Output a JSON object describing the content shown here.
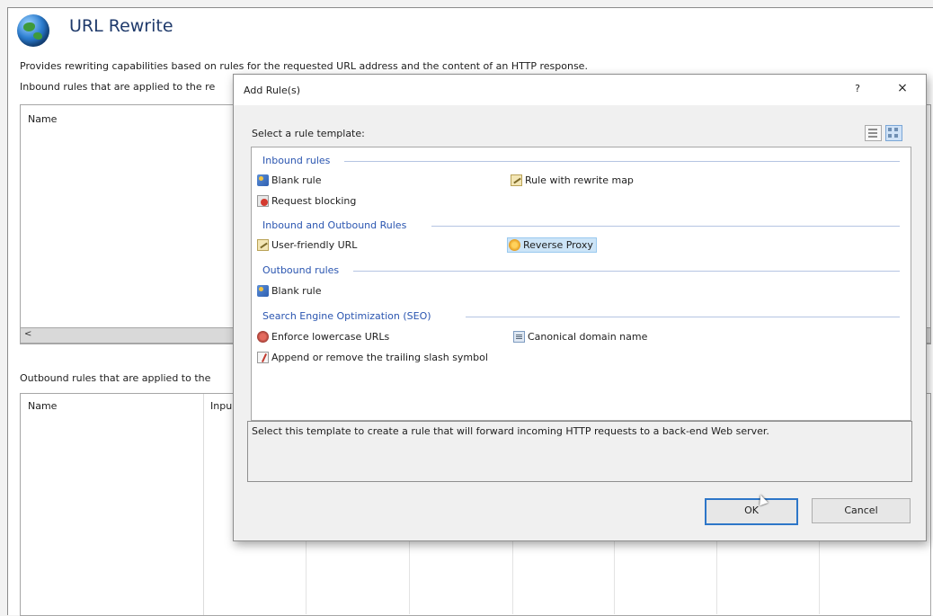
{
  "page": {
    "title": "URL Rewrite",
    "description": "Provides rewriting capabilities based on rules for the requested URL address and the content of an HTTP response.",
    "inbound_label": "Inbound rules that are applied to the re",
    "outbound_label": "Outbound rules that are applied to the",
    "inbound_grid": {
      "columns": [
        "Name"
      ],
      "scroll_left_arrow": "<"
    },
    "outbound_grid": {
      "columns": [
        "Name",
        "Inpu"
      ]
    },
    "icon": "globe-icon"
  },
  "dialog": {
    "title": "Add Rule(s)",
    "help": "?",
    "close": "×",
    "select_label": "Select a rule template:",
    "view_buttons": [
      "list-view-icon",
      "tile-view-icon"
    ],
    "groups": [
      {
        "heading": "Inbound rules",
        "items": [
          {
            "label": "Blank rule",
            "icon": "blank-rule-icon"
          },
          {
            "label": "Rule with rewrite map",
            "icon": "rewrite-map-icon"
          },
          {
            "label": "Request blocking",
            "icon": "request-blocking-icon"
          }
        ]
      },
      {
        "heading": "Inbound and Outbound Rules",
        "items": [
          {
            "label": "User-friendly URL",
            "icon": "user-friendly-url-icon"
          },
          {
            "label": "Reverse Proxy",
            "icon": "reverse-proxy-icon",
            "selected": true
          }
        ]
      },
      {
        "heading": "Outbound rules",
        "items": [
          {
            "label": "Blank rule",
            "icon": "blank-rule-icon"
          }
        ]
      },
      {
        "heading": "Search Engine Optimization (SEO)",
        "items": [
          {
            "label": "Enforce lowercase URLs",
            "icon": "lowercase-url-icon"
          },
          {
            "label": "Canonical domain name",
            "icon": "canonical-domain-icon"
          },
          {
            "label": "Append or remove the trailing slash symbol",
            "icon": "trailing-slash-icon"
          }
        ]
      }
    ],
    "template_description": "Select this template to create a rule that will forward incoming HTTP requests to a back-end Web server.",
    "ok_label": "OK",
    "cancel_label": "Cancel"
  },
  "colors": {
    "group_heading": "#2a55b0",
    "selection": "#cce4f7",
    "ok_border": "#2d76c8"
  }
}
